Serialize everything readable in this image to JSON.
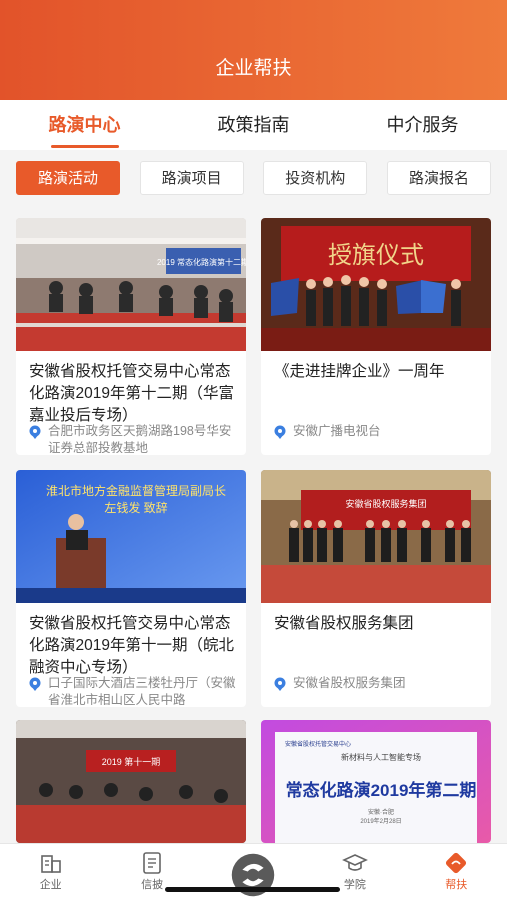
{
  "header": {
    "title": "企业帮扶"
  },
  "tabs": [
    {
      "label": "路演中心",
      "active": true
    },
    {
      "label": "政策指南",
      "active": false
    },
    {
      "label": "中介服务",
      "active": false
    }
  ],
  "subtabs": [
    {
      "label": "路演活动",
      "active": true
    },
    {
      "label": "路演项目",
      "active": false
    },
    {
      "label": "投资机构",
      "active": false
    },
    {
      "label": "路演报名",
      "active": false
    }
  ],
  "cards": [
    {
      "title": "安徽省股权托管交易中心常态化路演2019年第十二期（华富嘉业投后专场）",
      "location": "合肥市政务区天鹅湖路198号华安证券总部投教基地"
    },
    {
      "title": "《走进挂牌企业》一周年",
      "location": "安徽广播电视台"
    },
    {
      "title": "安徽省股权托管交易中心常态化路演2019年第十一期（皖北融资中心专场）",
      "location": "口子国际大酒店三楼牡丹厅（安徽省淮北市相山区人民中路"
    },
    {
      "title": "安徽省股权服务集团",
      "location": "安徽省股权服务集团"
    },
    {
      "banner": {
        "text": "2019 第十一期"
      }
    },
    {
      "banner": {
        "org": "安徽省股权托管交易中心",
        "subtitle": "新材料与人工智能专场",
        "headline": "常态化路演2019年第二期",
        "sub1": "安徽·合肥",
        "sub2": "2019年2月28日"
      }
    }
  ],
  "photo_text": {
    "card1_screen": "2019 常态化路演第十二期",
    "card2_banner": "授旗仪式",
    "card3_line1": "淮北市地方金融监督管理局副局长",
    "card3_line2": "左钱发  致辞",
    "card4_banner": "安徽省股权服务集团"
  },
  "tabbar": [
    {
      "label": "企业",
      "icon": "enterprise-icon",
      "active": false
    },
    {
      "label": "信披",
      "icon": "disclosure-icon",
      "active": false
    },
    {
      "label": "",
      "icon": "center-logo-icon",
      "active": false
    },
    {
      "label": "学院",
      "icon": "academy-icon",
      "active": false
    },
    {
      "label": "帮扶",
      "icon": "support-icon",
      "active": true
    }
  ],
  "colors": {
    "accent": "#e85a2a",
    "header_start": "#e2532a",
    "header_end": "#ef7a3b"
  }
}
